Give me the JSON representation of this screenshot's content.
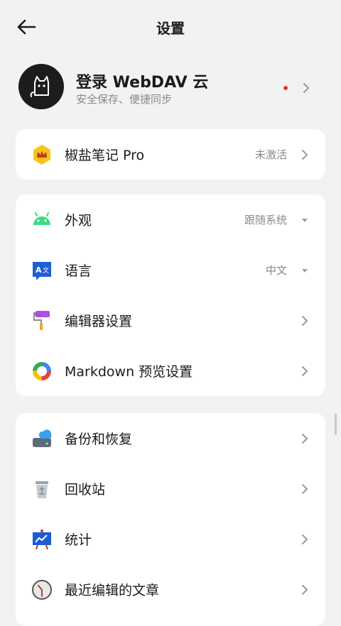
{
  "header": {
    "title": "设置"
  },
  "account": {
    "name": "登录 WebDAV 云",
    "subtitle": "安全保存、便捷同步"
  },
  "pro": {
    "label": "椒盐笔记 Pro",
    "value": "未激活"
  },
  "group1": [
    {
      "label": "外观",
      "value": "跟随系统",
      "icon": "android-icon"
    },
    {
      "label": "语言",
      "value": "中文",
      "icon": "translate-icon"
    },
    {
      "label": "编辑器设置",
      "value": "",
      "icon": "paint-roller-icon"
    },
    {
      "label": "Markdown 预览设置",
      "value": "",
      "icon": "color-ring-icon"
    }
  ],
  "group2": [
    {
      "label": "备份和恢复",
      "icon": "cloud-drive-icon"
    },
    {
      "label": "回收站",
      "icon": "recycle-bin-icon"
    },
    {
      "label": "统计",
      "icon": "chart-board-icon"
    },
    {
      "label": "最近编辑的文章",
      "icon": "clock-icon"
    }
  ],
  "colors": {
    "accent_red": "#e53935",
    "android_green": "#3ddc84",
    "pro_gold": "#f5c518"
  }
}
